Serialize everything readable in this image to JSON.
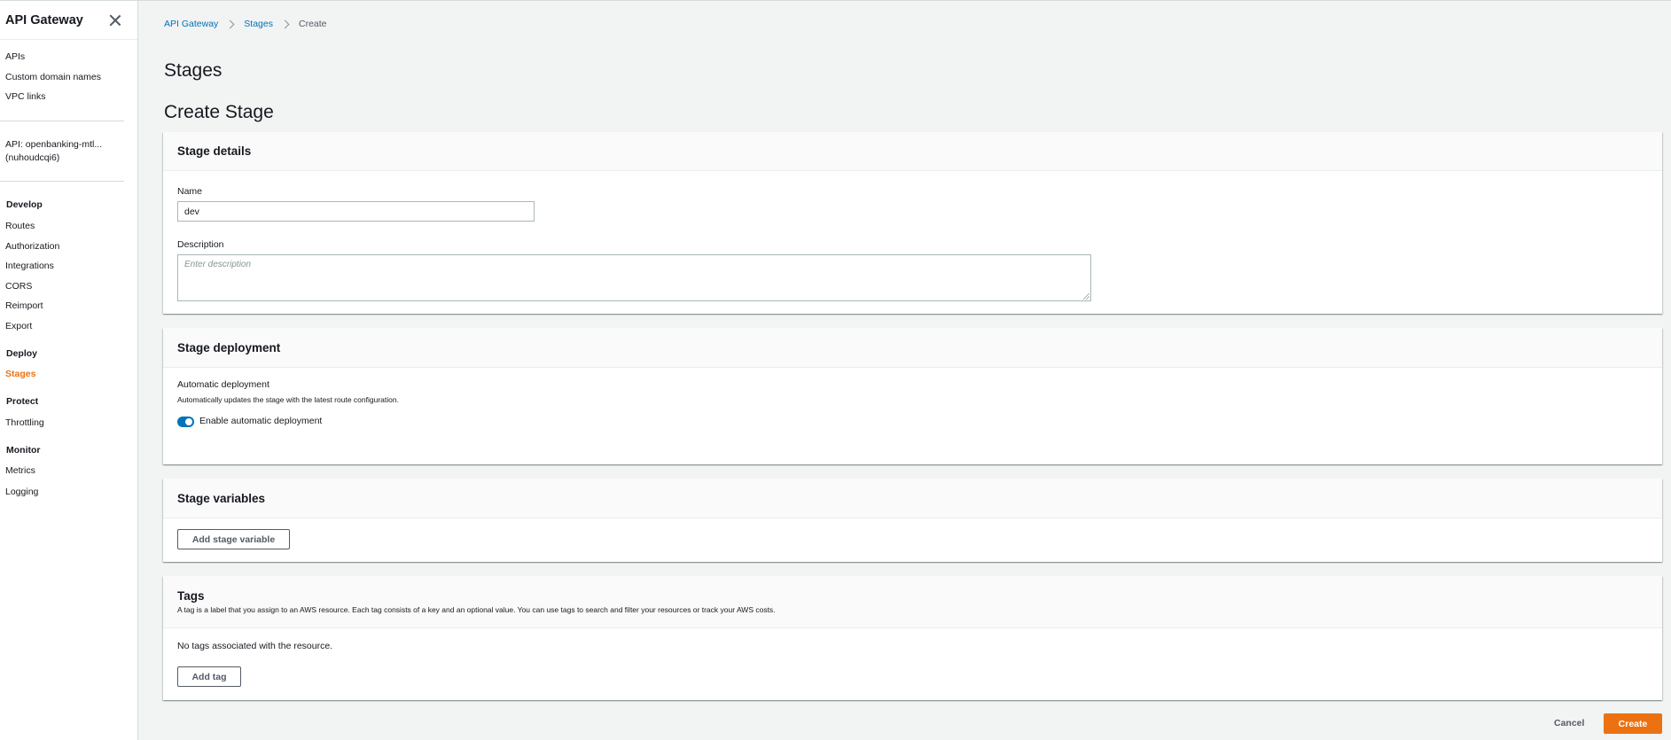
{
  "sidebar": {
    "title": "API Gateway",
    "top_links": [
      "APIs",
      "Custom domain names",
      "VPC links"
    ],
    "api_line1": "API: openbanking-mtl...",
    "api_line2": "(nuhoudcqi6)",
    "sections": {
      "develop": "Develop",
      "deploy": "Deploy",
      "protect": "Protect",
      "monitor": "Monitor"
    },
    "develop_items": [
      "Routes",
      "Authorization",
      "Integrations",
      "CORS",
      "Reimport",
      "Export"
    ],
    "deploy_items": [
      "Stages"
    ],
    "protect_items": [
      "Throttling"
    ],
    "monitor_items": [
      "Metrics",
      "Logging"
    ]
  },
  "breadcrumb": {
    "items": [
      "API Gateway",
      "Stages"
    ],
    "current": "Create"
  },
  "page": {
    "title": "Stages",
    "subtitle": "Create Stage"
  },
  "stage_details": {
    "title": "Stage details",
    "name_label": "Name",
    "name_value": "dev",
    "description_label": "Description",
    "description_placeholder": "Enter description"
  },
  "stage_deployment": {
    "title": "Stage deployment",
    "auto_label": "Automatic deployment",
    "auto_desc": "Automatically updates the stage with the latest route configuration.",
    "toggle_label": "Enable automatic deployment",
    "toggle_on": true
  },
  "stage_variables": {
    "title": "Stage variables",
    "add_button": "Add stage variable"
  },
  "tags": {
    "title": "Tags",
    "description": "A tag is a label that you assign to an AWS resource. Each tag consists of a key and an optional value. You can use tags to search and filter your resources or track your AWS costs.",
    "empty_text": "No tags associated with the resource.",
    "add_button": "Add tag"
  },
  "footer": {
    "cancel": "Cancel",
    "create": "Create"
  },
  "colors": {
    "accent": "#ec7211",
    "link": "#0073bb"
  }
}
